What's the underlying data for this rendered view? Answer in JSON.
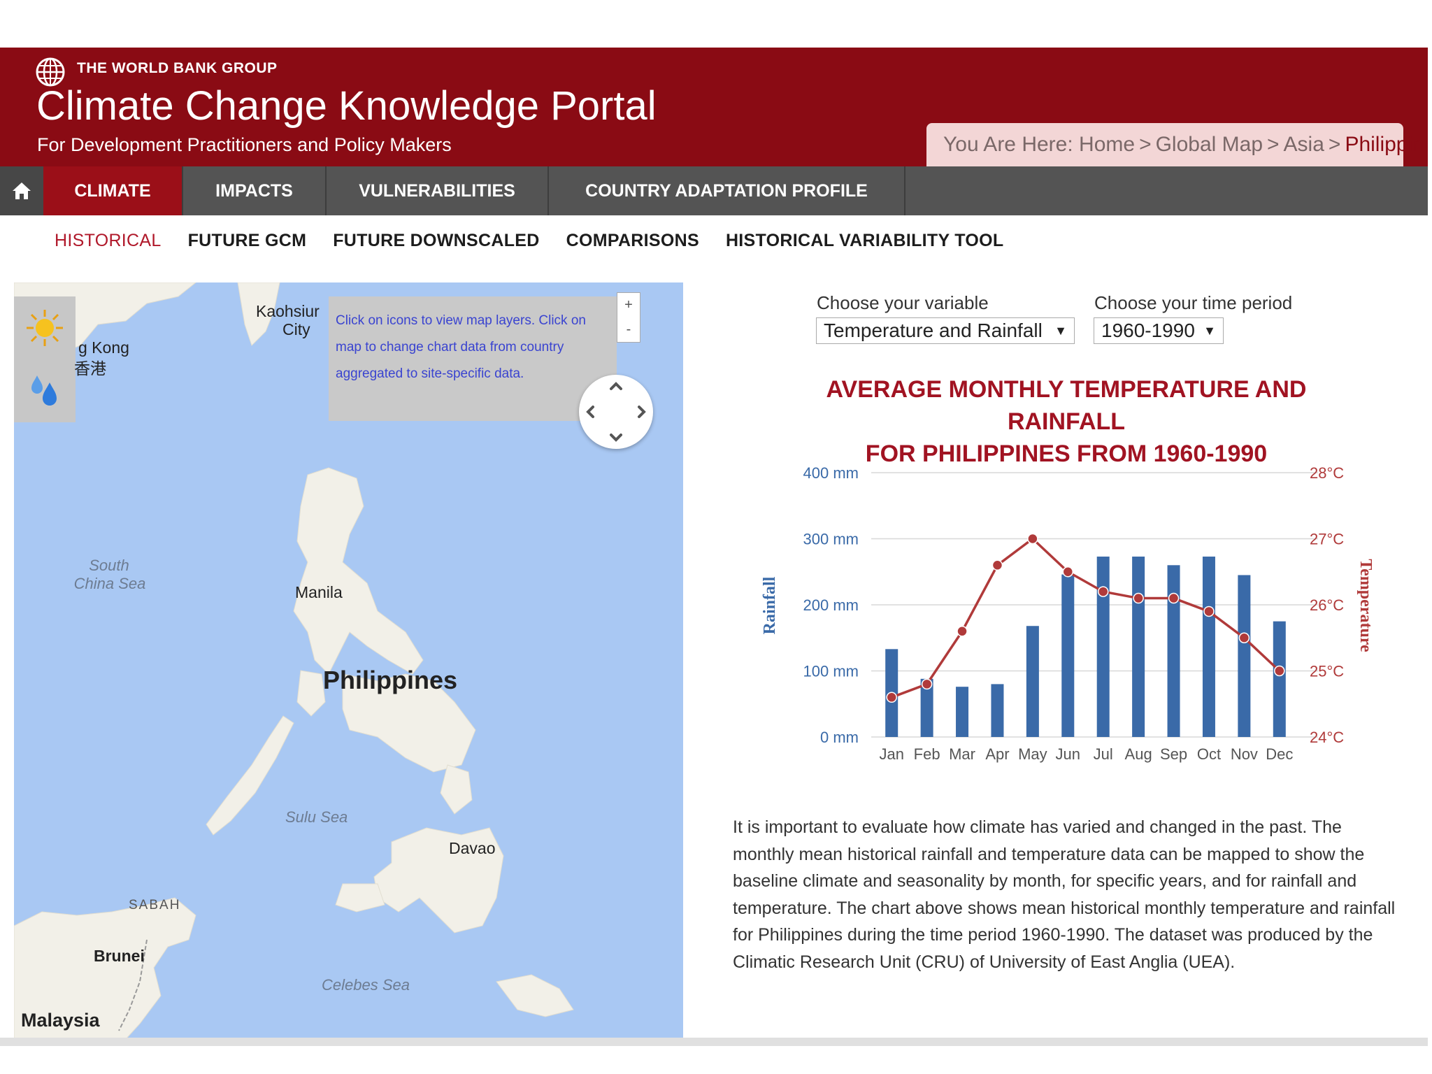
{
  "header": {
    "org_name": "THE WORLD BANK GROUP",
    "title": "Climate Change Knowledge Portal",
    "subtitle": "For Development Practitioners and Policy Makers",
    "logo_icon": "globe-icon",
    "breadcrumb": {
      "prefix": "You Are Here:",
      "items": [
        "Home",
        "Global Map",
        "Asia",
        "Philippines"
      ],
      "separator": ">"
    }
  },
  "main_nav": {
    "home_icon": "home-icon",
    "items": [
      "CLIMATE",
      "IMPACTS",
      "VULNERABILITIES",
      "COUNTRY ADAPTATION PROFILE"
    ],
    "active": "CLIMATE"
  },
  "sub_nav": {
    "items": [
      "HISTORICAL",
      "FUTURE GCM",
      "FUTURE DOWNSCALED",
      "COMPARISONS",
      "HISTORICAL VARIABILITY TOOL"
    ],
    "active": "HISTORICAL"
  },
  "map": {
    "tooltip": "Click on icons to view map layers. Click on map to change chart data from country aggregated to site-specific data.",
    "zoom_in": "+",
    "zoom_out": "-",
    "layer_icons": [
      "sun-icon",
      "rain-drops-icon"
    ],
    "labels": {
      "kaohsiung_1": "Kaohsiur",
      "kaohsiung_2": "City",
      "hongkong_1": "g Kong",
      "hongkong_2": "香港",
      "south_china_sea_1": "South",
      "south_china_sea_2": "China Sea",
      "manila": "Manila",
      "philippines": "Philippines",
      "sulu_sea": "Sulu Sea",
      "davao": "Davao",
      "sabah": "SABAH",
      "brunei": "Brunei",
      "celebes_sea": "Celebes Sea",
      "malaysia": "Malaysia"
    }
  },
  "controls": {
    "variable_label": "Choose your variable",
    "variable_value": "Temperature and Rainfall",
    "period_label": "Choose your time period",
    "period_value": "1960-1990",
    "dropdown_arrow": "▼"
  },
  "chart_data": {
    "type": "bar",
    "title": "AVERAGE MONTHLY TEMPERATURE AND RAINFALL FOR PHILIPPINES FROM 1960-1990",
    "title_line1": "AVERAGE MONTHLY TEMPERATURE AND RAINFALL",
    "title_line2": "FOR PHILIPPINES FROM 1960-1990",
    "categories": [
      "Jan",
      "Feb",
      "Mar",
      "Apr",
      "May",
      "Jun",
      "Jul",
      "Aug",
      "Sep",
      "Oct",
      "Nov",
      "Dec"
    ],
    "series": [
      {
        "name": "Rainfall",
        "type": "bar",
        "axis": "left",
        "color": "#3a6aa8",
        "values": [
          133,
          88,
          76,
          80,
          168,
          246,
          273,
          273,
          260,
          273,
          245,
          175
        ]
      },
      {
        "name": "Temperature",
        "type": "line",
        "axis": "right",
        "color": "#b03a3a",
        "values": [
          24.6,
          24.8,
          25.6,
          26.6,
          27.0,
          26.5,
          26.2,
          26.1,
          26.1,
          25.9,
          25.5,
          25.0
        ]
      }
    ],
    "ylabel": "Rainfall",
    "y2label": "Temperature",
    "ylim": [
      0,
      400
    ],
    "y2lim": [
      24,
      28
    ],
    "yticks": [
      "0 mm",
      "100 mm",
      "200 mm",
      "300 mm",
      "400 mm"
    ],
    "y2ticks": [
      "24°C",
      "25°C",
      "26°C",
      "27°C",
      "28°C"
    ],
    "grid": true,
    "legend": "none"
  },
  "description": "It is important to evaluate how climate has varied and changed in the past. The monthly mean historical rainfall and temperature data can be mapped to show the baseline climate and seasonality by month, for specific years, and for rainfall and temperature. The chart above shows mean historical monthly temperature and rainfall for Philippines during the time period 1960-1990. The dataset was produced by the Climatic Research Unit (CRU) of University of East Anglia (UEA).",
  "colors": {
    "brand_red": "#8a0b14",
    "nav_gray": "#545454",
    "active_nav": "#9b0f18",
    "map_water": "#a9c8f3",
    "map_land": "#f2f0e8"
  }
}
